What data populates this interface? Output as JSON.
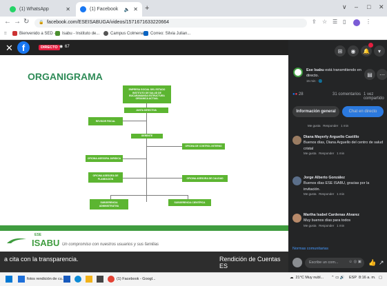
{
  "browser": {
    "tabs": [
      {
        "label": "(1) WhatsApp",
        "icon": "whatsapp-icon",
        "color": "#25d366"
      },
      {
        "label": "(1) Facebook",
        "icon": "facebook-icon",
        "color": "#1877f2"
      }
    ],
    "new_tab": "+",
    "url": "facebook.com/ESEISABUGA/videos/1571671633220664",
    "window_controls": [
      "∨",
      "–",
      "□",
      "✕"
    ],
    "bookmarks": [
      {
        "label": "Bienvenido a SED -..."
      },
      {
        "label": "Isabu - Instituto de..."
      },
      {
        "label": "Campus Colmena"
      },
      {
        "label": "Correo: Silvia Julian..."
      }
    ]
  },
  "video": {
    "live_badge": "DIRECTO",
    "viewers": "67",
    "slide_title": "ORGANIGRAMA",
    "org": {
      "root": "EMPRESA SOCIAL DEL ESTADO INSTITUTO DE SALUD DE BUCARAMANGA ESTRUCTURA ORGANICA ACTUAL",
      "junta": "JUNTA DIRECTIVA",
      "revisor": "REVISOR FISCAL",
      "gerente": "GERENTE",
      "control": "OFICINA DE CONTROL INTERNO",
      "juridica": "OFICINA ASESORA JURIDICA",
      "planeacion": "OFICINA ASESORA DE PLANEACIÓN",
      "calidad": "OFICINA ASESORA DE CALIDAD",
      "administrativa": "SUBGERENCIA ADMINISTRATIVA",
      "cientifica": "SUBGERENCIA CIENTÍFICA"
    },
    "logo_small": "ESE",
    "logo_text": "ISABU",
    "slogan": "Un compromiso con nuestros usuarios y sus familias",
    "ticker_left": "a cita con la transparencia.",
    "ticker_right": "Rendición de Cuentas ES"
  },
  "facebook": {
    "page_name": "Ese Isabu",
    "live_text": "está transmitiendo en directo.",
    "time": "15 min",
    "reactions": "28",
    "comments_count": "31 comentarios",
    "shares": "1 vez compartido",
    "tab_info": "Información general",
    "tab_live": "Chat en directo",
    "comments": [
      {
        "name": "Diana Mayerly Arguello Castillo",
        "text": "Buenos días, Diana Arguello del centro de salud cristal",
        "color": "#9a7c62"
      },
      {
        "name": "Jorge Alberto González",
        "text": "Buenos días ESE ISABU, gracias por la invitación.",
        "color": "#5b6f8a"
      },
      {
        "name": "Martha Isabel Cardenas Alvarez",
        "text": "Muy buenos días para todos",
        "color": "#b88a6a"
      }
    ],
    "meta_like": "Me gusta",
    "meta_reply": "Responder",
    "meta_time": "1 min",
    "norms": "Normas comunitarias",
    "input_placeholder": "Escribe un com..."
  },
  "taskbar": {
    "items": [
      {
        "label": "fotos rendición de cu..."
      },
      {
        "label": "(1) Facebook - Googl..."
      }
    ],
    "weather": "21°C Muy nubl...",
    "lang": "ESP",
    "time": "8:16 a. m."
  }
}
